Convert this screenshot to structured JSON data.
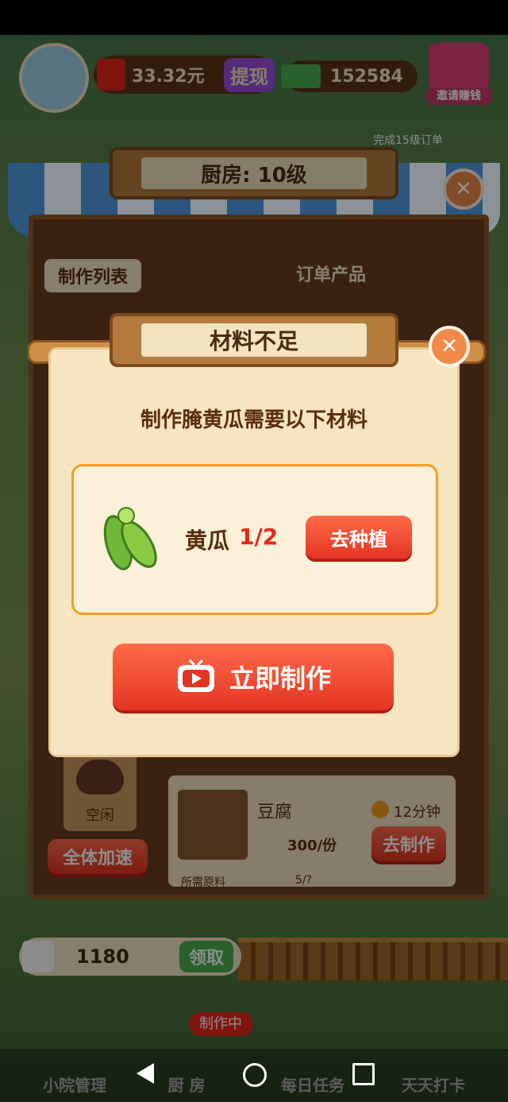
{
  "top_bar": {
    "cash": "33.32元",
    "withdraw": "提现",
    "coins": "152584",
    "invite": "邀请赚钱"
  },
  "background_hint": "完成15级订单",
  "kitchen": {
    "title": "厨房: 10级",
    "list_title": "制作列表",
    "order_header": "订单产品",
    "slot_status": "空闲",
    "speed_all": "全体加速",
    "product": {
      "name": "豆腐",
      "timer": "12分钟",
      "price": "300/份",
      "make_label": "去制作",
      "materials_label": "所需原料",
      "materials_count": "5/?"
    }
  },
  "modal": {
    "title": "材料不足",
    "message": "制作腌黄瓜需要以下材料",
    "item_name": "黄瓜",
    "item_count": "1/2",
    "plant_button": "去种植",
    "make_now_button": "立即制作"
  },
  "bottom": {
    "reward_amount": "1180",
    "claim": "领取",
    "making_badge": "制作中",
    "nav": [
      "小院管理",
      "厨 房",
      "每日任务",
      "天天打卡"
    ]
  },
  "colors": {
    "accent_red": "#e43522",
    "modal_bg": "#f7e4c0",
    "count_red": "#e8261a",
    "title_brown": "#5a2d0c"
  },
  "icons": [
    "cucumber-icon",
    "tv-play-icon",
    "alarm-clock-icon",
    "cash-icon",
    "gift-icon",
    "tofu-icon",
    "pot-icon",
    "calendar-icon"
  ]
}
